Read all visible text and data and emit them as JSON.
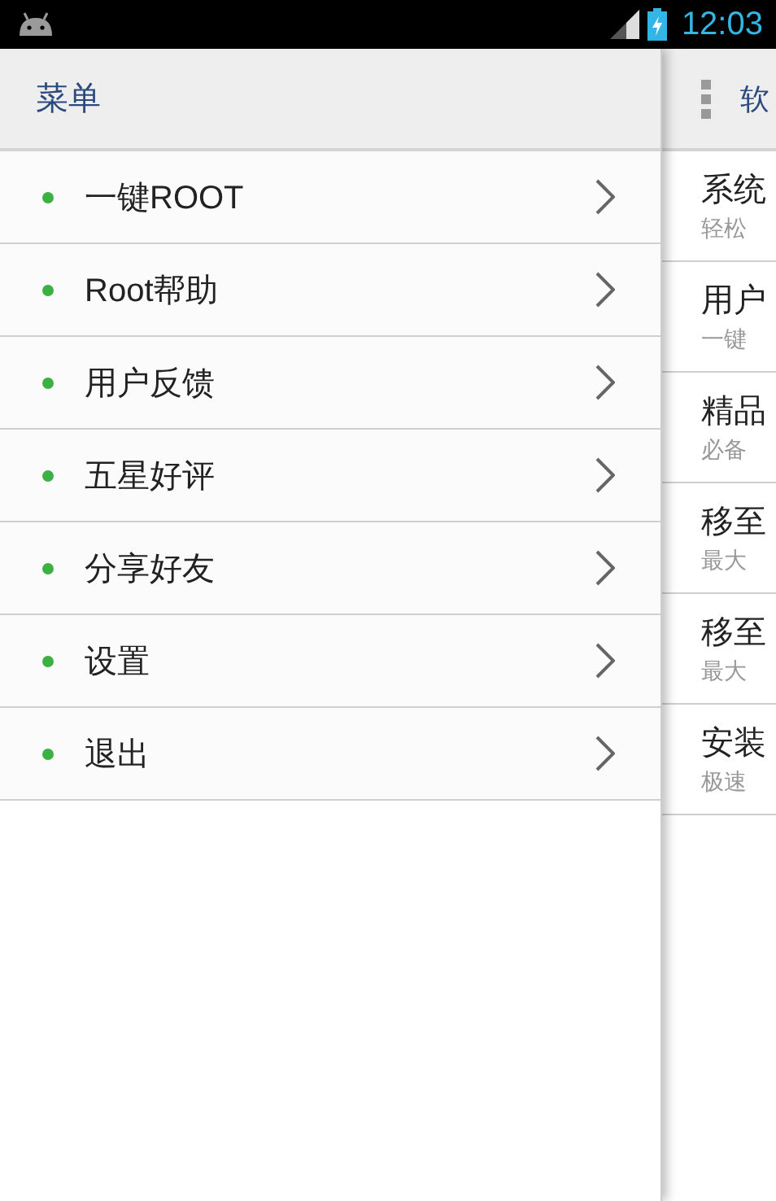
{
  "status_bar": {
    "time": "12:03"
  },
  "drawer": {
    "title": "菜单",
    "items": [
      {
        "label": "一键ROOT",
        "color": "#3cb043"
      },
      {
        "label": "Root帮助",
        "color": "#3cb043"
      },
      {
        "label": "用户反馈",
        "color": "#3cb043"
      },
      {
        "label": "五星好评",
        "color": "#3cb043"
      },
      {
        "label": "分享好友",
        "color": "#3cb043"
      },
      {
        "label": "设置",
        "color": "#3cb043"
      },
      {
        "label": "退出",
        "color": "#3cb043"
      }
    ]
  },
  "main": {
    "title": "软",
    "items": [
      {
        "title": "系统",
        "subtitle": "轻松"
      },
      {
        "title": "用户",
        "subtitle": "一键"
      },
      {
        "title": "精品",
        "subtitle": "必备"
      },
      {
        "title": "移至",
        "subtitle": "最大"
      },
      {
        "title": "移至",
        "subtitle": "最大"
      },
      {
        "title": "安装",
        "subtitle": "极速"
      }
    ]
  }
}
